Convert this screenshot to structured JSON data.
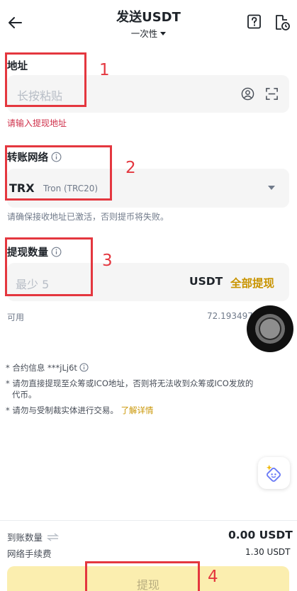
{
  "header": {
    "title": "发送USDT",
    "mode": "一次性"
  },
  "address": {
    "label": "地址",
    "placeholder": "长按粘贴",
    "error": "请输入提现地址"
  },
  "network": {
    "label": "转账网络",
    "symbol": "TRX",
    "name": "Tron (TRC20)",
    "hint": "请确保接收地址已激活，否则提币将失败。"
  },
  "amount": {
    "label": "提现数量",
    "placeholder": "最少 5",
    "unit": "USDT",
    "max_label": "全部提现",
    "available_label": "可用",
    "available_value": "72.193497"
  },
  "notes": {
    "contract_info": "* 合约信息 ***jLj6t",
    "ico_warning_line1": "* 请勿直接提现至众筹或ICO地址，否则将无法收到众筹或ICO发放的",
    "ico_warning_line2": "代币。",
    "sanction_warning": "* 请勿与受制裁实体进行交易。",
    "learn_more": "了解详情"
  },
  "summary": {
    "receive_label": "到账数量",
    "receive_value": "0.00 USDT",
    "fee_label": "网络手续费",
    "fee_value": "1.30 USDT"
  },
  "submit_label": "提现",
  "annotations": [
    "1",
    "2",
    "3",
    "4"
  ],
  "colors": {
    "accent": "#c99400",
    "error": "#cf304a",
    "annotation": "#e4373f",
    "button_disabled": "#fbeeaf"
  }
}
